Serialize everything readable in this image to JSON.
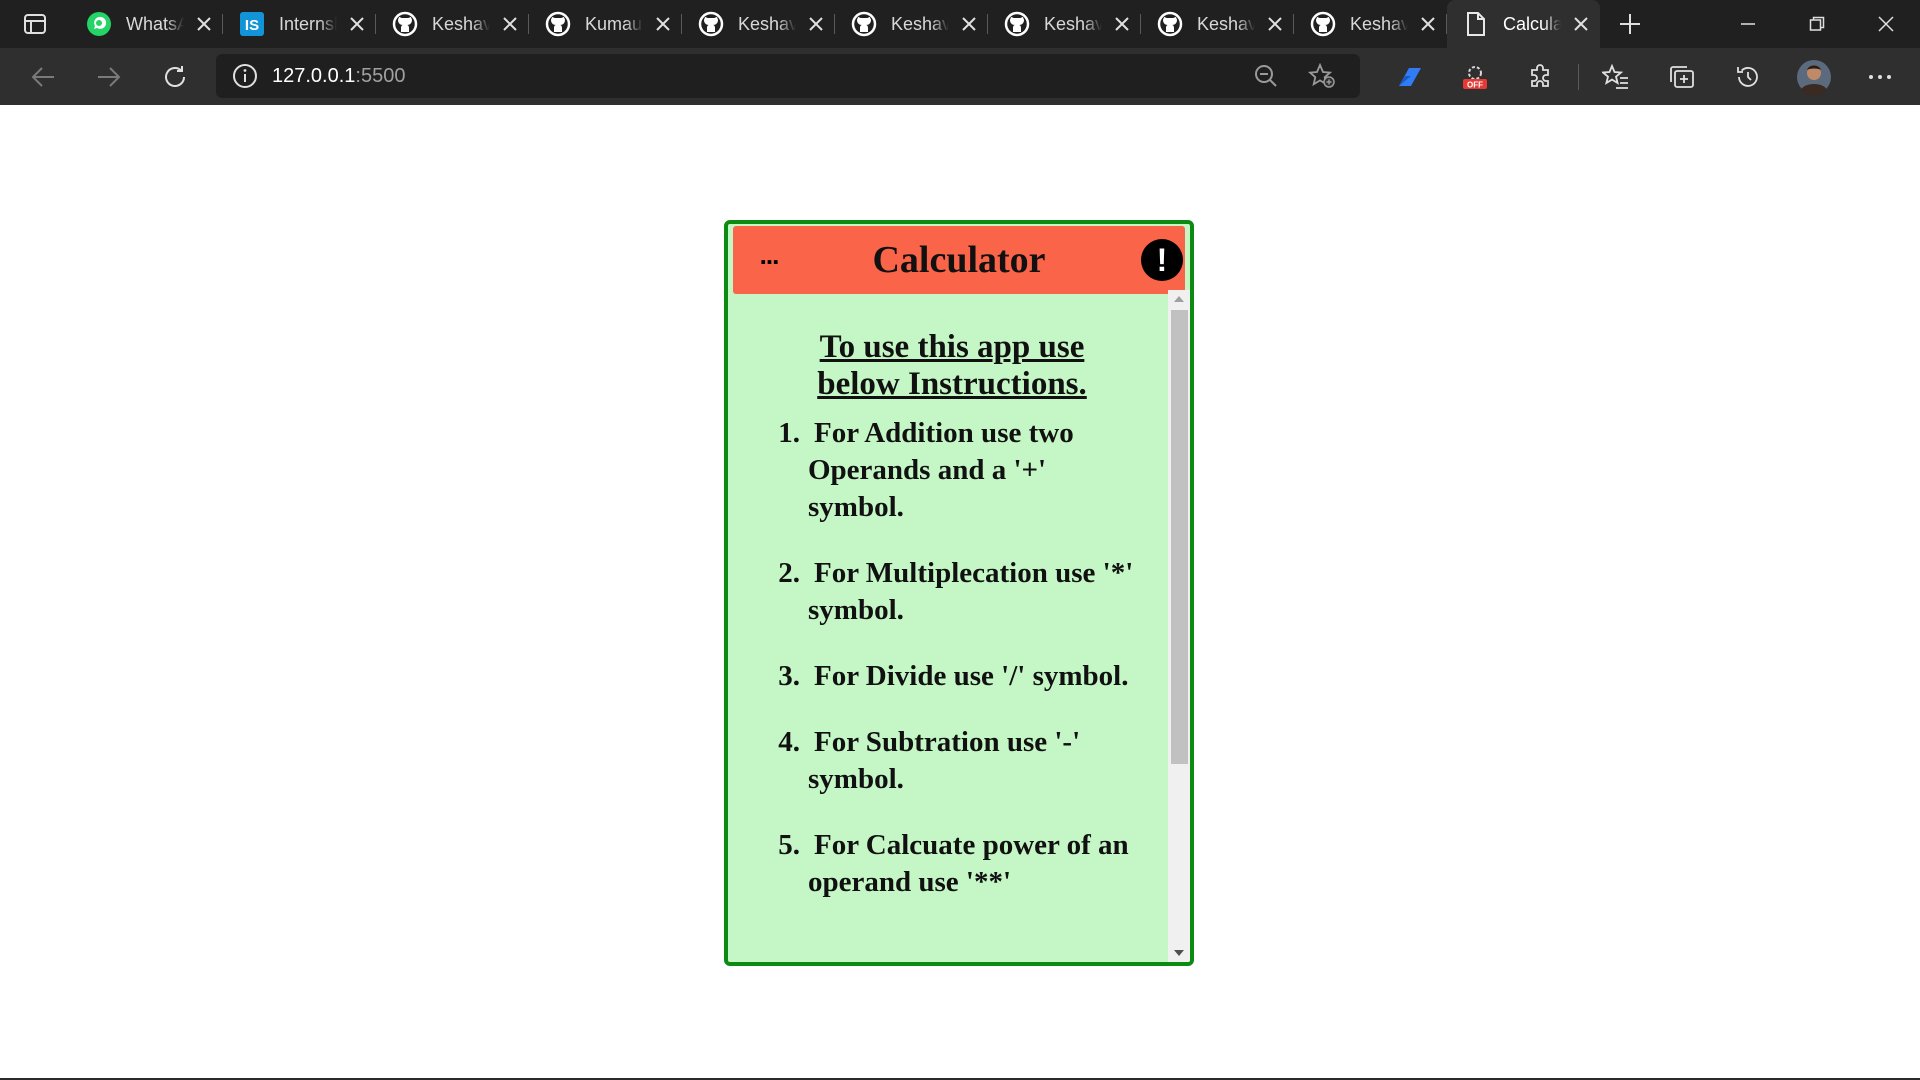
{
  "browser": {
    "tabs": [
      {
        "title": "WhatsApp",
        "favicon": "whatsapp-icon",
        "active": false
      },
      {
        "title": "Internshala",
        "favicon": "internshala-icon",
        "active": false
      },
      {
        "title": "Keshav",
        "favicon": "github-icon",
        "active": false
      },
      {
        "title": "Kumau",
        "favicon": "github-icon",
        "active": false
      },
      {
        "title": "Keshav",
        "favicon": "github-icon",
        "active": false
      },
      {
        "title": "Keshav",
        "favicon": "github-icon",
        "active": false
      },
      {
        "title": "Keshav",
        "favicon": "github-icon",
        "active": false
      },
      {
        "title": "Keshav",
        "favicon": "github-icon",
        "active": false
      },
      {
        "title": "Keshav",
        "favicon": "github-icon",
        "active": false
      },
      {
        "title": "Calculator",
        "favicon": "page-icon",
        "active": true
      }
    ],
    "address": {
      "host": "127.0.0.1",
      "port": ":5500"
    },
    "colors": {
      "tabbar": "#202020",
      "toolbar": "#2f2f2f",
      "addressbar": "#1f1f1f"
    }
  },
  "calculator": {
    "title": "Calculator",
    "menu_label": "...",
    "info_label": "!",
    "heading": "To use this app use below Instructions.",
    "instructions": [
      {
        "num": "1.",
        "text": "For Addition use two Operands and a '+' symbol."
      },
      {
        "num": "2.",
        "text": "For Multiplecation use '*' symbol."
      },
      {
        "num": "3.",
        "text": "For Divide use '/' symbol."
      },
      {
        "num": "4.",
        "text": "For Subtration use '-' symbol."
      },
      {
        "num": "5.",
        "text": "For Calcuate power of an operand use '**'"
      }
    ],
    "colors": {
      "border": "#0d8a12",
      "header": "#fa6448",
      "body": "#c5f7c6"
    }
  }
}
